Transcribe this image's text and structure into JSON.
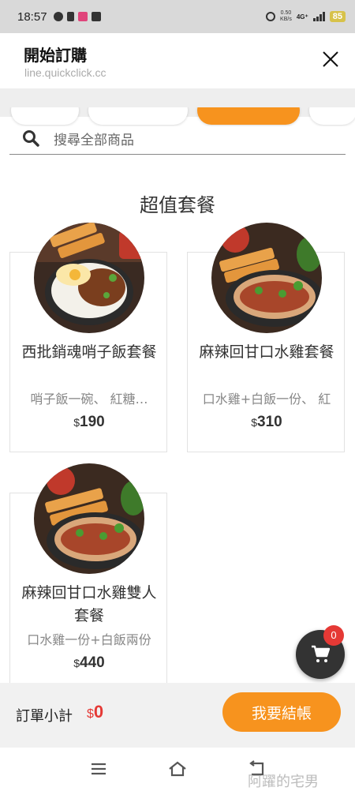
{
  "status": {
    "time": "18:57",
    "speed_top": "0.50",
    "speed_unit": "KB/s",
    "network": "4G⁺",
    "battery": "85"
  },
  "header": {
    "title": "開始訂購",
    "url": "line.quickclick.cc"
  },
  "search": {
    "placeholder": "搜尋全部商品"
  },
  "section": {
    "title": "超值套餐"
  },
  "products": [
    {
      "name": "西批銷魂哨子飯套餐",
      "desc": "哨子飯一碗、 紅糖…",
      "currency": "$",
      "price": "190"
    },
    {
      "name": "麻辣回甘口水雞套餐",
      "desc": "口水雞+白飯一份、 紅",
      "currency": "$",
      "price": "310"
    },
    {
      "name": "麻辣回甘口水雞雙人套餐",
      "desc": "口水雞一份+白飯兩份",
      "currency": "$",
      "price": "440"
    }
  ],
  "cart": {
    "count": "0"
  },
  "checkout": {
    "subtotal_label": "訂單小計",
    "currency": "$",
    "subtotal": "0",
    "button_label": "我要結帳"
  },
  "watermark": "阿躍的宅男",
  "colors": {
    "accent": "#f7931e",
    "badge": "#e53935",
    "cart_fab": "#333333"
  }
}
